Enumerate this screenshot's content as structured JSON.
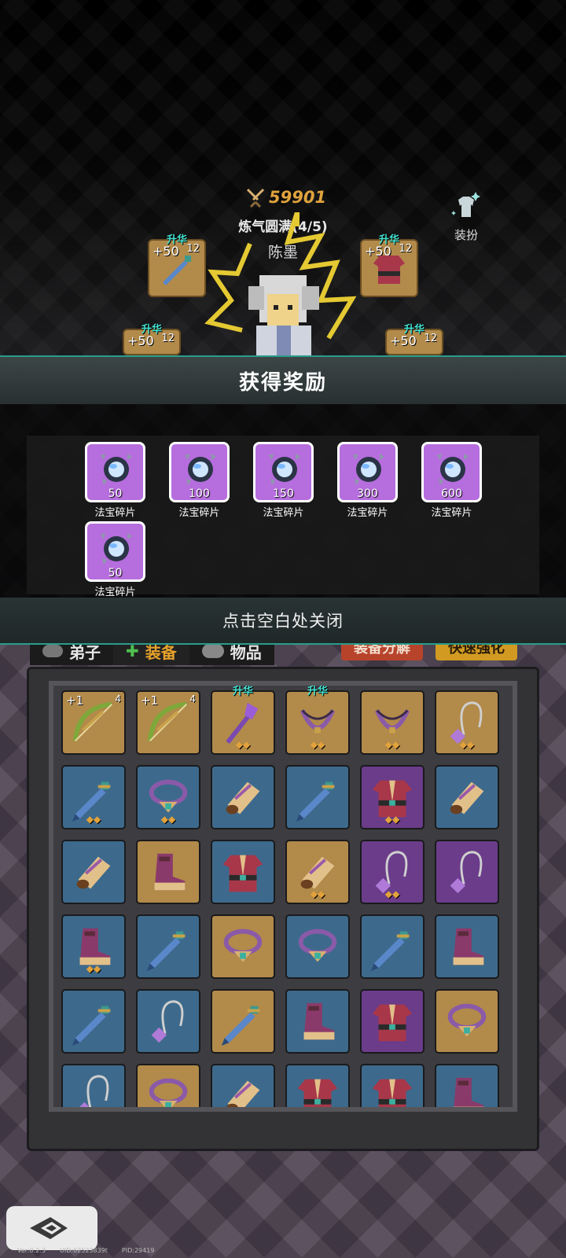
{
  "character": {
    "power": "59901",
    "realm": "炼气圆满(4/5)",
    "name": "陈墨",
    "outfit_label": "装扮",
    "equipped_slots": [
      {
        "slot": "weapon",
        "plus": "+50",
        "level": "12",
        "tag": "升华",
        "icon": "sword-icon"
      },
      {
        "slot": "armor",
        "plus": "+50",
        "level": "12",
        "tag": "升华",
        "icon": "robe-icon"
      },
      {
        "slot": "ring",
        "plus": "+50",
        "level": "12",
        "tag": "升华",
        "icon": "amulet-icon"
      },
      {
        "slot": "boots",
        "plus": "+50",
        "level": "12",
        "tag": "升华",
        "icon": "boots-icon"
      }
    ]
  },
  "reward_popup": {
    "title": "获得奖励",
    "close_hint": "点击空白处关闭",
    "items": [
      {
        "name": "法宝碎片",
        "count": "50",
        "icon": "treasure-fragment-icon"
      },
      {
        "name": "法宝碎片",
        "count": "100",
        "icon": "treasure-fragment-icon"
      },
      {
        "name": "法宝碎片",
        "count": "150",
        "icon": "treasure-fragment-icon"
      },
      {
        "name": "法宝碎片",
        "count": "300",
        "icon": "treasure-fragment-icon"
      },
      {
        "name": "法宝碎片",
        "count": "600",
        "icon": "treasure-fragment-icon"
      },
      {
        "name": "法宝碎片",
        "count": "50",
        "icon": "treasure-fragment-icon"
      }
    ]
  },
  "inventory": {
    "tabs": [
      {
        "label": "弟子",
        "icon": "disciple-icon"
      },
      {
        "label": "装备",
        "icon": "equipment-icon"
      },
      {
        "label": "物品",
        "icon": "item-icon"
      }
    ],
    "active_tab": "装备",
    "decompose_label": "装备分解",
    "enhance_label": "快速强化",
    "items": [
      {
        "icon": "bow-icon",
        "rarity": "gold",
        "plus": "+1",
        "level": "4",
        "badge": ""
      },
      {
        "icon": "bow-icon",
        "rarity": "gold",
        "plus": "+1",
        "level": "4",
        "badge": ""
      },
      {
        "icon": "staff-icon",
        "rarity": "gold",
        "tag": "升华",
        "badge": "◆◆"
      },
      {
        "icon": "necklace-icon",
        "rarity": "gold",
        "tag": "升华",
        "badge": "◆◆"
      },
      {
        "icon": "necklace-icon",
        "rarity": "gold",
        "badge": "◆◆"
      },
      {
        "icon": "pendant-icon",
        "rarity": "gold",
        "badge": "◆◆"
      },
      {
        "icon": "sword-icon",
        "rarity": "blue",
        "badge": "◆◆"
      },
      {
        "icon": "amulet-icon",
        "rarity": "blue",
        "badge": "◆◆"
      },
      {
        "icon": "bracer-icon",
        "rarity": "blue",
        "badge": ""
      },
      {
        "icon": "sword-icon",
        "rarity": "blue",
        "badge": ""
      },
      {
        "icon": "robe-icon",
        "rarity": "purple",
        "badge": "◆◆"
      },
      {
        "icon": "bracer-icon",
        "rarity": "blue",
        "badge": ""
      },
      {
        "icon": "bracer-icon",
        "rarity": "blue",
        "badge": ""
      },
      {
        "icon": "boots-icon",
        "rarity": "gold",
        "badge": ""
      },
      {
        "icon": "robe-icon",
        "rarity": "blue",
        "badge": ""
      },
      {
        "icon": "bracer-icon",
        "rarity": "gold",
        "badge": "◆◆"
      },
      {
        "icon": "pendant-icon",
        "rarity": "purple",
        "badge": "◆◆"
      },
      {
        "icon": "pendant-icon",
        "rarity": "purple",
        "badge": ""
      },
      {
        "icon": "boots-icon",
        "rarity": "blue",
        "badge": "◆◆"
      },
      {
        "icon": "sword-icon",
        "rarity": "blue",
        "badge": ""
      },
      {
        "icon": "amulet-icon",
        "rarity": "gold",
        "badge": ""
      },
      {
        "icon": "amulet-icon",
        "rarity": "blue",
        "badge": ""
      },
      {
        "icon": "sword-icon",
        "rarity": "blue",
        "badge": ""
      },
      {
        "icon": "boots-icon",
        "rarity": "blue",
        "badge": ""
      },
      {
        "icon": "sword-icon",
        "rarity": "blue",
        "badge": ""
      },
      {
        "icon": "pendant-icon",
        "rarity": "blue",
        "badge": ""
      },
      {
        "icon": "sword-icon",
        "rarity": "gold",
        "badge": ""
      },
      {
        "icon": "boots-icon",
        "rarity": "blue",
        "badge": ""
      },
      {
        "icon": "robe-icon",
        "rarity": "purple",
        "badge": ""
      },
      {
        "icon": "amulet-icon",
        "rarity": "gold",
        "badge": ""
      },
      {
        "icon": "pendant-icon",
        "rarity": "blue",
        "badge": ""
      },
      {
        "icon": "amulet-icon",
        "rarity": "gold",
        "badge": ""
      },
      {
        "icon": "bracer-icon",
        "rarity": "blue",
        "badge": ""
      },
      {
        "icon": "robe-icon",
        "rarity": "blue",
        "badge": ""
      },
      {
        "icon": "robe-icon",
        "rarity": "blue",
        "badge": ""
      },
      {
        "icon": "boots-icon",
        "rarity": "blue",
        "badge": ""
      }
    ]
  },
  "footer": {
    "version": "Ver:0.2.3",
    "uid": "UID:62523839t",
    "pid": "PID:29419"
  },
  "colors": {
    "accent_teal": "#2a9c8c",
    "gold_text": "#e0a33d",
    "rarity_blue": "#3d6a8c",
    "rarity_gold": "#b28a4a",
    "rarity_purple": "#6a3c8a",
    "reward_purple": "#b66ddd"
  }
}
